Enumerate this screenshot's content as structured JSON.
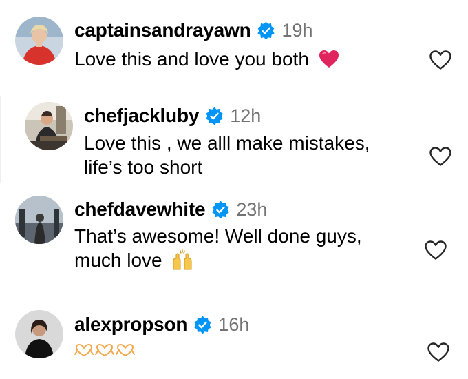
{
  "comments": [
    {
      "username": "captainsandrayawn",
      "time": "19h",
      "lines": [
        "Love this and love you both"
      ],
      "emoji": "red-heart",
      "verified": true
    },
    {
      "username": "chefjackluby",
      "time": "12h",
      "lines": [
        "Love this , we alll make mistakes,",
        "life’s too short"
      ],
      "verified": true
    },
    {
      "username": "chefdavewhite",
      "time": "23h",
      "lines": [
        "That’s awesome! Well done guys,",
        "much love"
      ],
      "emoji": "raising-hands",
      "verified": true
    },
    {
      "username": "alexpropson",
      "time": "16h",
      "lines": [
        ""
      ],
      "emoji": "heart-hands-x3",
      "verified": true
    }
  ],
  "colors": {
    "verified": "#0095f6",
    "time": "#737373",
    "heart_emoji": "#e0245e",
    "like_outline": "#262626"
  }
}
